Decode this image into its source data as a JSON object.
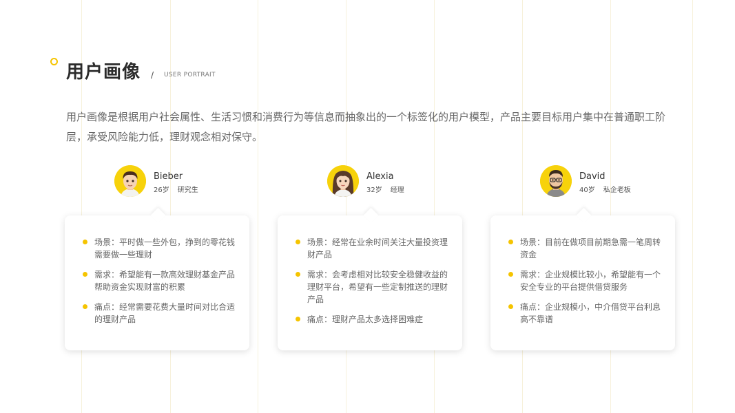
{
  "header": {
    "title": "用户画像",
    "separator": "/",
    "subtitle": "USER PORTRAIT"
  },
  "intro": "用户画像是根据用户社会属性、生活习惯和消费行为等信息而抽象出的一个标签化的用户模型，产品主要目标用户集中在普通职工阶层，承受风险能力低，理财观念相对保守。",
  "colors": {
    "accent": "#f5c400",
    "avatar_bg": "#f7d20b"
  },
  "personas": [
    {
      "name": "Bieber",
      "age": "26岁",
      "job": "研究生",
      "avatar_icon": "male-avatar-icon",
      "items": [
        "场景：平时做一些外包，挣到的零花钱需要做一些理财",
        "需求：希望能有一款高效理财基金产品帮助资金实现财富的积累",
        "痛点：经常需要花费大量时间对比合适的理财产品"
      ]
    },
    {
      "name": "Alexia",
      "age": "32岁",
      "job": "经理",
      "avatar_icon": "female-avatar-icon",
      "items": [
        "场景：经常在业余时间关注大量投资理财产品",
        "需求：会考虑相对比较安全稳健收益的理财平台，希望有一些定制推送的理财产品",
        "痛点：理财产品太多选择困难症"
      ]
    },
    {
      "name": "David",
      "age": "40岁",
      "job": "私企老板",
      "avatar_icon": "bearded-male-avatar-icon",
      "items": [
        "场景：目前在做项目前期急需一笔周转资金",
        "需求：企业规模比较小，希望能有一个安全专业的平台提供借贷服务",
        "痛点：企业规模小，中介借贷平台利息高不靠谱"
      ]
    }
  ]
}
